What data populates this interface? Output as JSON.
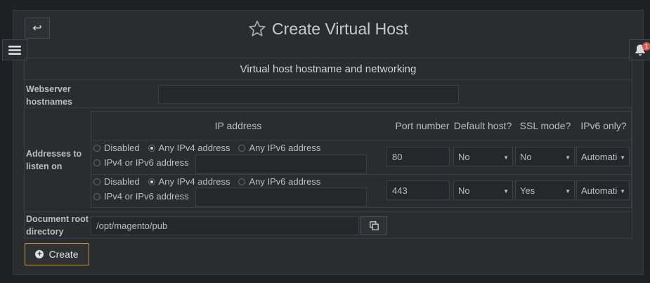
{
  "header": {
    "title": "Create Virtual Host",
    "back_icon": "return-arrow-icon",
    "star_icon": "star-icon"
  },
  "side": {
    "menu_icon": "hamburger-menu-icon",
    "bell_icon": "bell-icon",
    "bell_badge": "1"
  },
  "section": {
    "title": "Virtual host hostname and networking"
  },
  "form": {
    "hostnames_label": "Webserver hostnames",
    "hostnames_value": "",
    "addresses_label": "Addresses to listen on",
    "docroot_label": "Document root directory",
    "docroot_value": "/opt/magento/pub"
  },
  "addr_table": {
    "headers": {
      "ip": "IP address",
      "port": "Port number",
      "default": "Default host?",
      "ssl": "SSL mode?",
      "ipv6": "IPv6 only?"
    },
    "radio_labels": {
      "disabled": "Disabled",
      "any4": "Any IPv4 address",
      "any6": "Any IPv6 address",
      "either": "IPv4 or IPv6 address"
    },
    "rows": [
      {
        "selected": "any4",
        "ip_value": "",
        "port": "80",
        "default": "No",
        "ssl": "No",
        "ipv6": "Automatic"
      },
      {
        "selected": "any4",
        "ip_value": "",
        "port": "443",
        "default": "No",
        "ssl": "Yes",
        "ipv6": "Automatic"
      }
    ]
  },
  "actions": {
    "create_label": "Create"
  },
  "colors": {
    "accent_border": "#c8a030",
    "panel_bg": "#2b2c30",
    "badge": "#d9534f"
  }
}
